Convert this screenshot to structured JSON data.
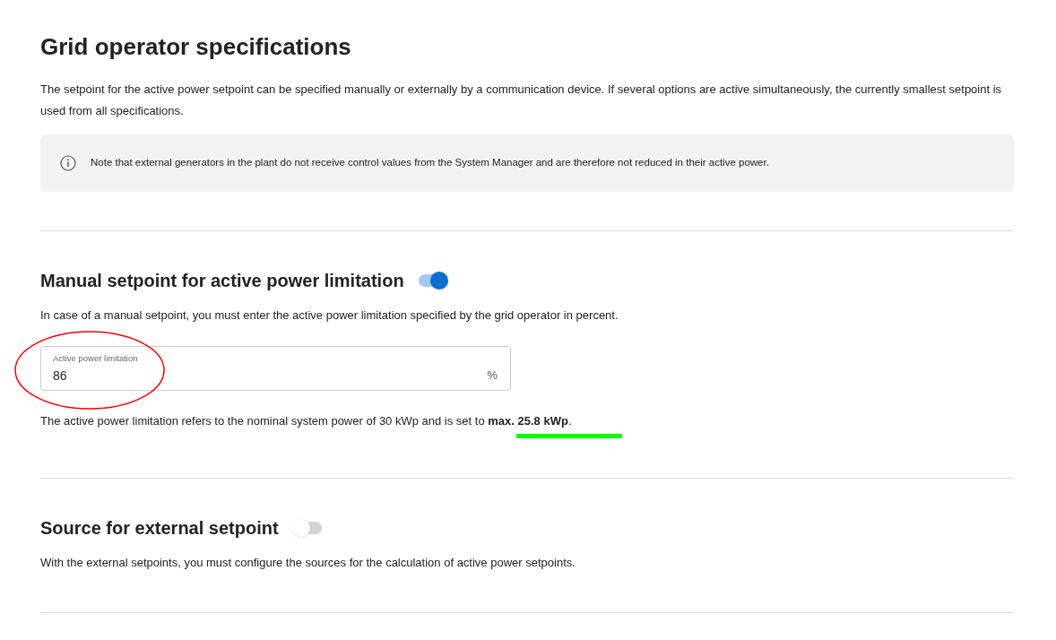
{
  "title": "Grid operator specifications",
  "intro": "The setpoint for the active power setpoint can be specified manually or externally by a communication device. If several options are active simultaneously, the currently smallest setpoint is used from all specifications.",
  "note": "Note that external generators in the plant do not receive control values from the System Manager and are therefore not reduced in their active power.",
  "sections": [
    {
      "kind": "manual",
      "heading": "Manual setpoint for active power limitation",
      "on": true,
      "description": "In case of a manual setpoint, you must enter the active power limitation specified by the grid operator in percent.",
      "field": {
        "label": "Active power limitation",
        "value": "86",
        "unit": "%"
      },
      "result": "The active power limitation refers to the nominal system power of 30 kWp and is set to **max. 25.8 kWp**."
    },
    {
      "kind": "external",
      "heading": "Source for external setpoint",
      "on": false,
      "description": "With the external setpoints, you must configure the sources for the calculation of active power setpoints."
    }
  ],
  "annotations": [
    {
      "kind": "ellipse",
      "color": "#ff0000"
    },
    {
      "kind": "underline",
      "color": "#00ff00"
    }
  ]
}
